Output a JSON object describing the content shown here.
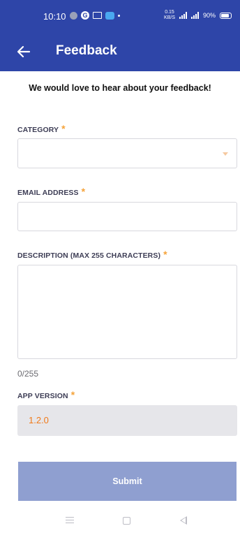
{
  "status_bar": {
    "time": "10:10",
    "net_speed_top": "0.15",
    "net_speed_bottom": "KB/S",
    "battery": "90%"
  },
  "app_bar": {
    "title": "Feedback",
    "back_icon": "arrow-left-icon"
  },
  "intro": "We would love to hear about your feedback!",
  "form": {
    "category": {
      "label": "CATEGORY",
      "value": ""
    },
    "email": {
      "label": "EMAIL ADDRESS",
      "value": ""
    },
    "description": {
      "label": "DESCRIPTION (MAX 255 CHARACTERS)",
      "value": "",
      "counter": "0/255"
    },
    "app_version": {
      "label": "APP VERSION",
      "value": "1.2.0"
    },
    "required_marker": "*",
    "submit_label": "Submit"
  },
  "colors": {
    "primary": "#2e45a8",
    "required": "#f5a33a",
    "submit_disabled": "#8f9fd0",
    "version_text": "#f07a1a"
  }
}
